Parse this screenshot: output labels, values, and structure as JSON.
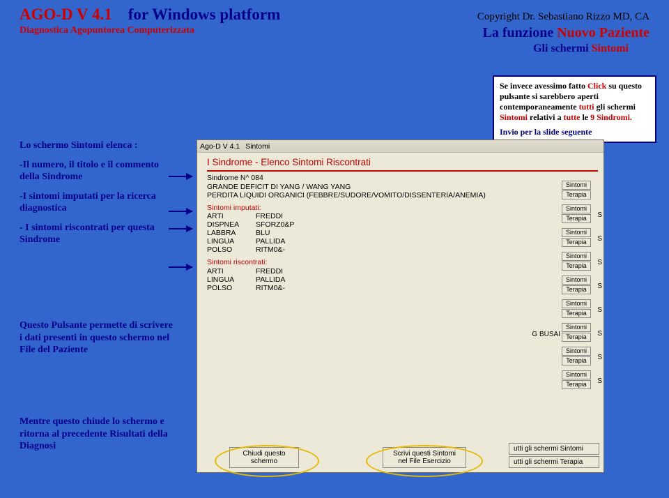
{
  "header": {
    "title_ago": "AGO-D V 4.1",
    "title_win": "for Windows platform",
    "copyright": "Copyright Dr. Sebastiano Rizzo MD, CA",
    "subtitle": "Diagnostica Agopuntorea Computerizzata",
    "funz_b": "La funzione ",
    "funz_r": "Nuovo Paziente",
    "gli_b": "Gli schermi ",
    "gli_r": "Sintomi"
  },
  "callout": {
    "p1a": "Se invece avessimo fatto ",
    "p1b": "Click",
    "p1c": " su questo pulsante si sarebbero aperti contemporaneamente ",
    "p1d": "tutti",
    "p1e": " gli schermi ",
    "p1f": "Sintomi",
    "p1g": " relativi a",
    "p1h": " tutte",
    "p1i": " le ",
    "p1j": "9 Sindromi.",
    "invio": "Invio per la slide seguente"
  },
  "left": {
    "p1": "Lo schermo Sintomi elenca :",
    "p2": "-Il numero, il titolo e  il commento della Sindrome",
    "p3": "-I sintomi imputati per la ricerca diagnostica",
    "p4": "- I sintomi riscontrati per questa Sindrome",
    "p5": "Questo Pulsante permette di scrivere i dati presenti in questo schermo nel File del Paziente",
    "p6": "Mentre questo chiude lo schermo e ritorna al precedente Risultati della Diagnosi"
  },
  "win": {
    "titlebar_app": "Ago-D V 4.1",
    "titlebar_doc": "Sintomi",
    "red_header": "I Sindrome - Elenco Sintomi Riscontrati",
    "sindrome_n": "Sindrome N^ 084",
    "grande": "GRANDE DEFICIT DI YANG  /  WANG YANG",
    "perdita": "PERDITA LIQUIDI ORGANICI (FEBBRE/SUDORE/VOMITO/DISSENTERIA/ANEMIA)",
    "imp_label": "Sintomi imputati:",
    "imp": [
      [
        "ARTI",
        "FREDDI"
      ],
      [
        "DISPNEA",
        "SFORZ0&P"
      ],
      [
        "LABBRA",
        "BLU"
      ],
      [
        "LINGUA",
        "PALLIDA"
      ],
      [
        "POLSO",
        "RITM0&-"
      ]
    ],
    "risc_label": "Sintomi riscontrati:",
    "risc": [
      [
        "ARTI",
        "FREDDI"
      ],
      [
        "LINGUA",
        "PALLIDA"
      ],
      [
        "POLSO",
        "RITM0&-"
      ]
    ],
    "side_labels": {
      "sintomi": "Sintomi",
      "terapia": "Terapia",
      "s": "S"
    },
    "gbusai": "G BUSAI",
    "btn_close": "Chiudi questo schermo",
    "btn_write": "Scrivi questi Sintomi nel File Esercizio",
    "btn_all_sint": "utti gli schermi Sintomi",
    "btn_all_ter": "utti gli schermi Terapia"
  }
}
